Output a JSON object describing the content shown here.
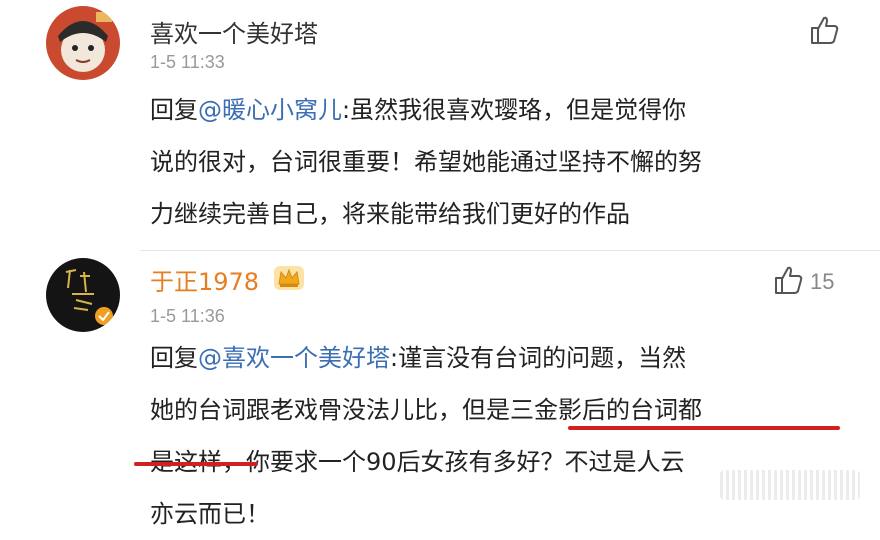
{
  "comments": [
    {
      "username": "喜欢一个美好塔",
      "time": "1-5 11:33",
      "like_count": "",
      "reply_prefix": "回复",
      "mention": "@暖心小窝儿",
      "lines": [
        ":虽然我很喜欢璎珞，但是觉得你",
        "说的很对，台词很重要！希望她能通过坚持不懈的努",
        "力继续完善自己，将来能带给我们更好的作品"
      ]
    },
    {
      "username": "于正1978",
      "time": "1-5 11:36",
      "like_count": "15",
      "reply_prefix": "回复",
      "mention": "@喜欢一个美好塔",
      "lines": [
        ":谨言没有台词的问题，当然",
        "她的台词跟老戏骨没法儿比，但是三金影后的台词都",
        "是这样，你要求一个90后女孩有多好？不过是人云",
        "亦云而已！"
      ]
    }
  ],
  "icons": {
    "like": "thumbs-up-icon",
    "crown": "crown-badge-icon",
    "verified": "verified-badge-icon"
  },
  "colors": {
    "mention": "#3b6eb5",
    "vip_name": "#e67e22",
    "underline": "#d21f1f"
  }
}
